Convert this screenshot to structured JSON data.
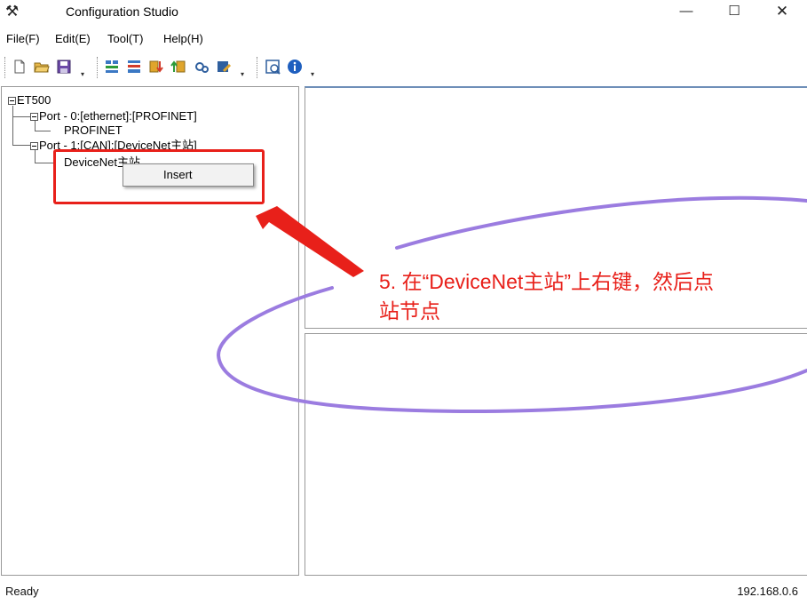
{
  "window": {
    "title": "Configuration Studio",
    "app_icon": "tools-icon",
    "controls": {
      "minimize": "—",
      "maximize": "☐",
      "close": "✕"
    }
  },
  "menu": [
    {
      "label": "File(F)"
    },
    {
      "label": "Edit(E)"
    },
    {
      "label": "Tool(T)"
    },
    {
      "label": "Help(H)"
    }
  ],
  "toolbar": {
    "groups": [
      [
        "new-file-icon",
        "open-folder-icon",
        "save-icon"
      ],
      [
        "add-module-icon",
        "remove-module-icon",
        "download-icon",
        "upload-icon",
        "settings-icon",
        "edit-icon"
      ],
      [
        "monitor-icon",
        "info-icon"
      ]
    ]
  },
  "tree": {
    "root": "ET500",
    "port0": "Port - 0:[ethernet]:[PROFINET]",
    "port0_child": "PROFINET",
    "port1": "Port - 1:[CAN]:[DeviceNet主站]",
    "port1_child": "DeviceNet主站"
  },
  "context_menu": {
    "items": [
      {
        "label": "Insert"
      }
    ]
  },
  "annotation": {
    "line1": "5. 在“DeviceNet主站”上右键，然后点",
    "line2": "站节点",
    "color": "#e8201a",
    "ellipse_color": "#9b7ce0"
  },
  "status": {
    "left": "Ready",
    "right": "192.168.0.6"
  }
}
